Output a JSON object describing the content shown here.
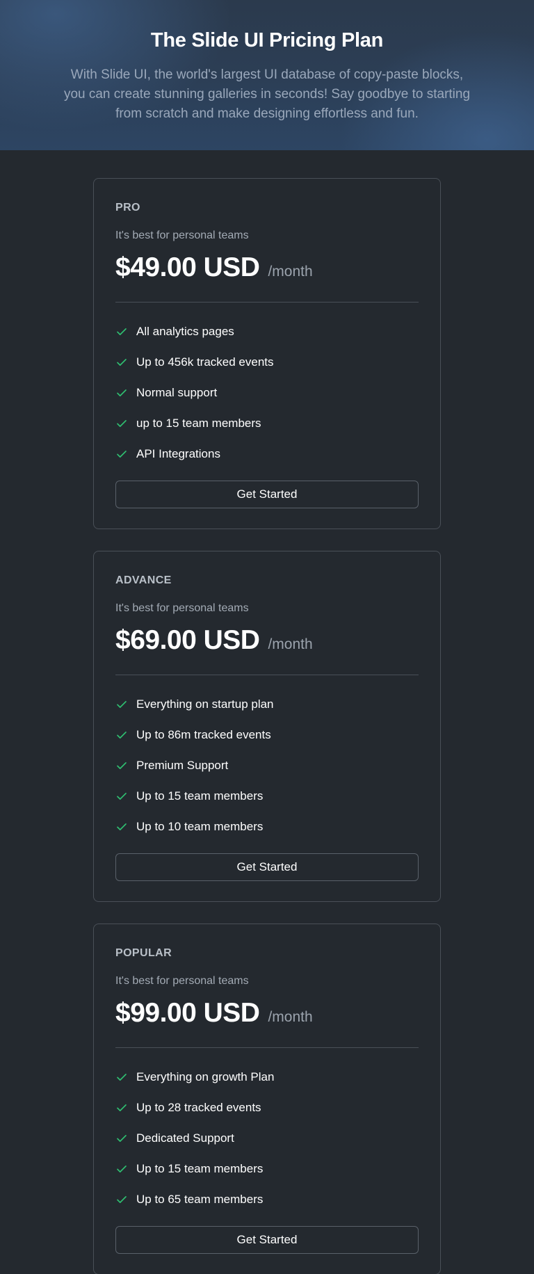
{
  "hero": {
    "title": "The Slide UI Pricing Plan",
    "description": "With Slide UI, the world's largest UI database of copy-paste blocks, you can create stunning galleries in seconds! Say goodbye to starting from scratch and make designing effortless and fun."
  },
  "colors": {
    "background": "#24292f",
    "check": "#2fbf71",
    "border": "#4a5058"
  },
  "plans": [
    {
      "name": "PRO",
      "description": "It's best for personal teams",
      "price": "$49.00 USD",
      "period": "/month",
      "features": [
        "All analytics pages",
        "Up to 456k tracked events",
        "Normal support",
        "up to 15 team members",
        "API Integrations"
      ],
      "cta": "Get Started"
    },
    {
      "name": "ADVANCE",
      "description": "It's best for personal teams",
      "price": "$69.00 USD",
      "period": "/month",
      "features": [
        "Everything on startup plan",
        "Up to 86m tracked events",
        "Premium Support",
        "Up to 15 team members",
        "Up to 10 team members"
      ],
      "cta": "Get Started"
    },
    {
      "name": "POPULAR",
      "description": "It's best for personal teams",
      "price": "$99.00 USD",
      "period": "/month",
      "features": [
        "Everything on growth Plan",
        "Up to 28 tracked events",
        "Dedicated Support",
        "Up to 15 team members",
        "Up to 65 team members"
      ],
      "cta": "Get Started"
    }
  ]
}
